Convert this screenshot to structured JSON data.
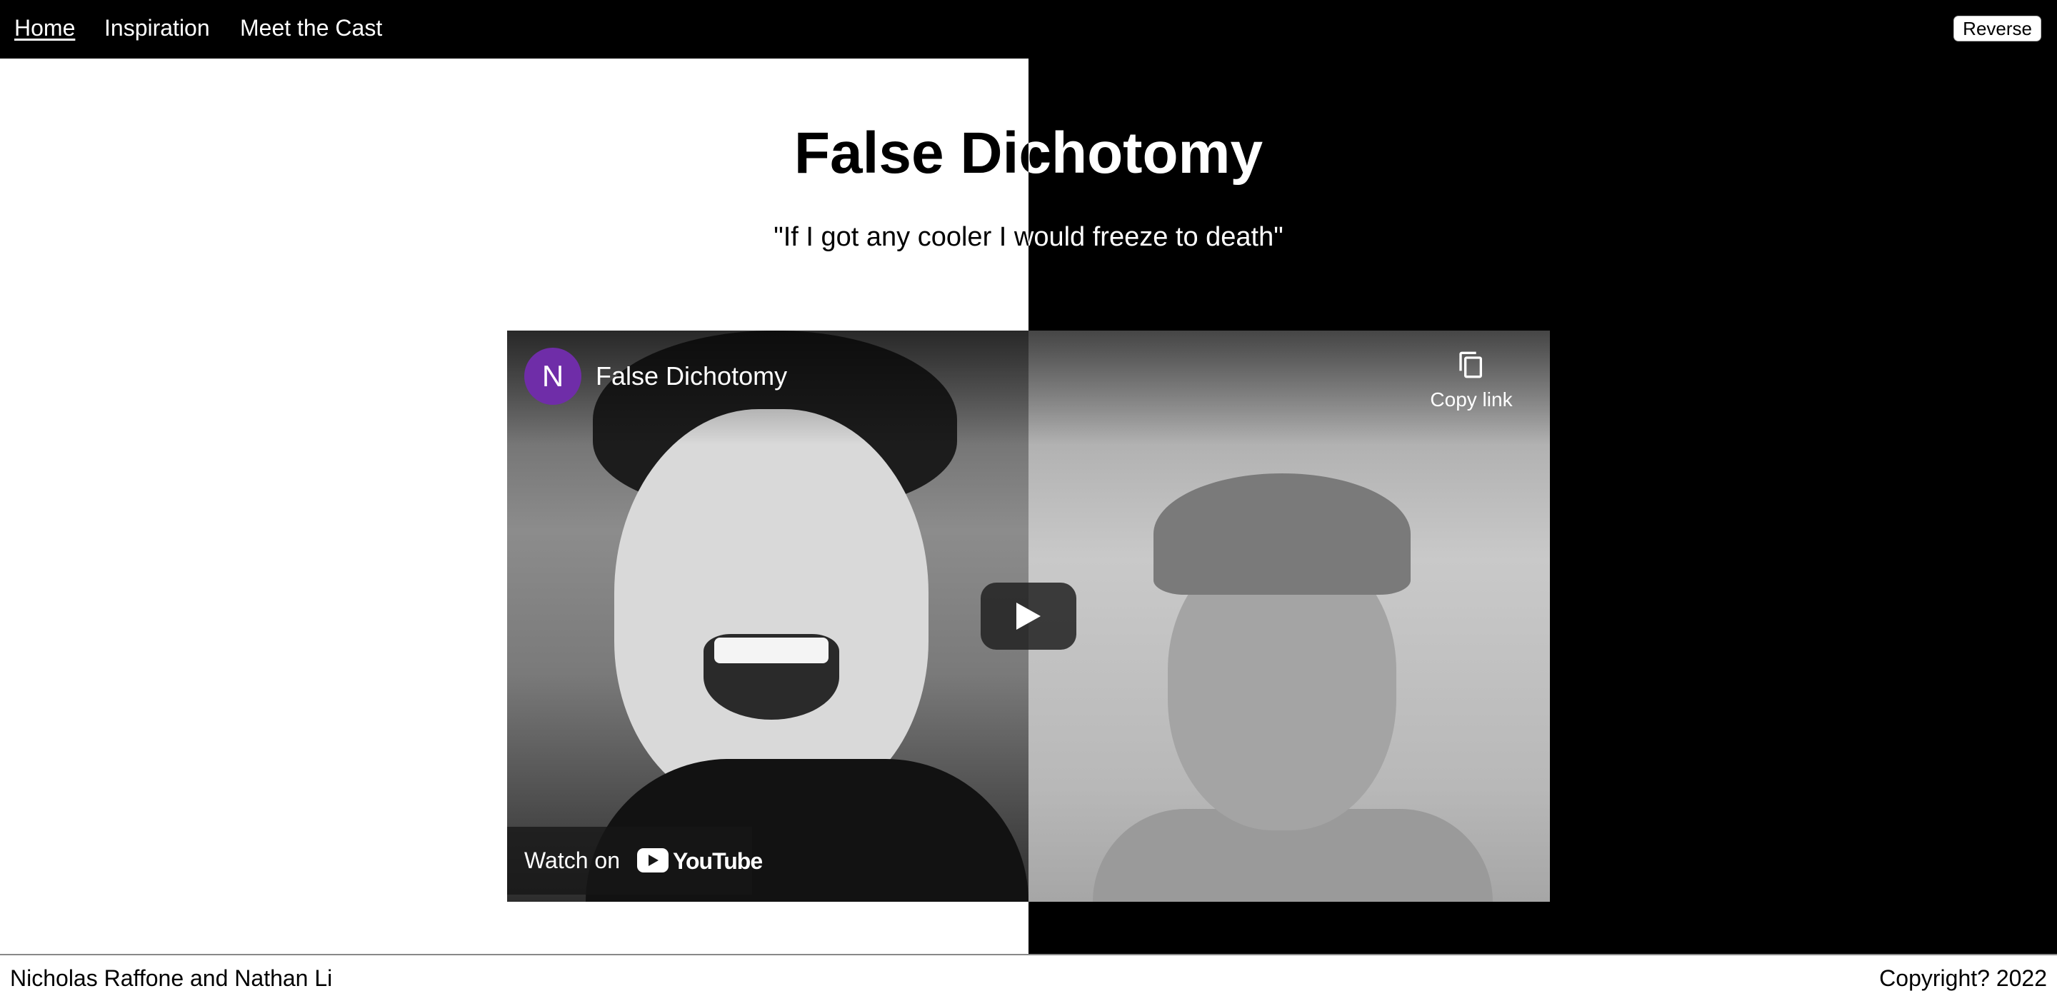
{
  "nav": {
    "links": [
      {
        "label": "Home",
        "active": true
      },
      {
        "label": "Inspiration",
        "active": false
      },
      {
        "label": "Meet the Cast",
        "active": false
      }
    ],
    "reverse_label": "Reverse"
  },
  "hero": {
    "title": "False Dichotomy",
    "quote": "\"If I got any cooler I would freeze to death\""
  },
  "video": {
    "channel_initial": "N",
    "title": "False Dichotomy",
    "copy_link_label": "Copy link",
    "watch_on_label": "Watch on",
    "youtube_wordmark": "YouTube",
    "play_icon": "play-icon",
    "copy_icon": "copy-icon",
    "avatar_color": "#6f2da8"
  },
  "footer": {
    "authors": "Nicholas Raffone and Nathan Li",
    "copyright": "Copyright? 2022"
  },
  "colors": {
    "left_half": "#ffffff",
    "right_half": "#000000"
  }
}
